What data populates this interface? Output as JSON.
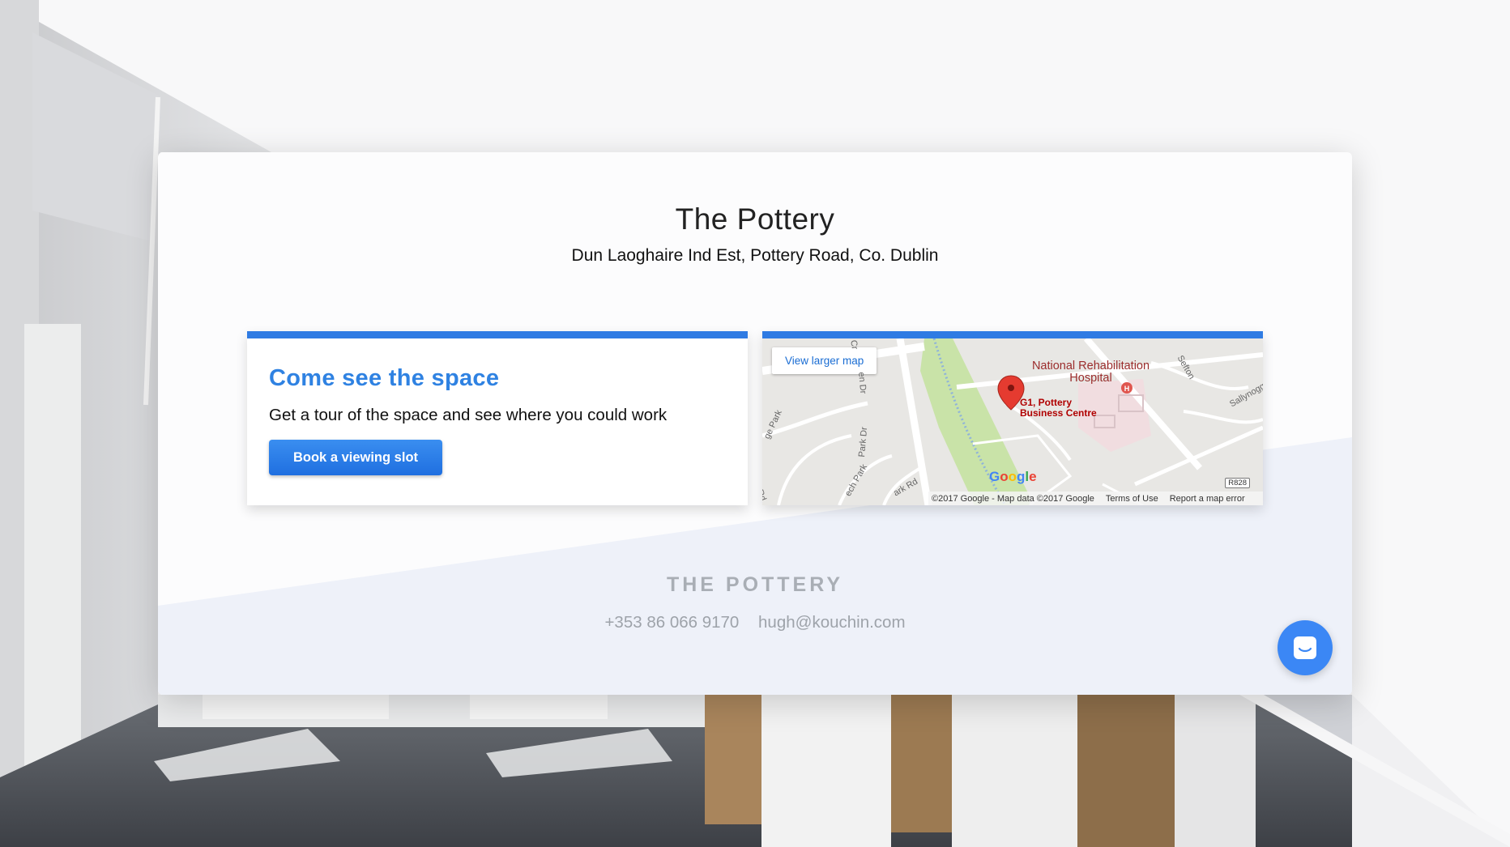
{
  "header": {
    "title": "The Pottery",
    "address": "Dun Laoghaire Ind Est, Pottery Road, Co. Dublin"
  },
  "cta": {
    "heading": "Come see the space",
    "text": "Get a tour of the space and see where you could work",
    "button_label": "Book a viewing slot"
  },
  "map": {
    "view_larger": "View larger map",
    "place_name": "National Rehabilitation Hospital",
    "pin_label": "G1, Pottery Business Centre",
    "streets": [
      "Sefton",
      "Sallynoggin",
      "en Dr",
      "ge Park",
      "Park Dr",
      "ech Park",
      "ark Rd",
      "Rd",
      "Cr"
    ],
    "road_badge": "R828",
    "hospital_marker": "H",
    "google_logo": "Google",
    "footer": {
      "copyright": "©2017 Google - Map data ©2017 Google",
      "terms": "Terms of Use",
      "report": "Report a map error"
    }
  },
  "footer": {
    "brand": "THE POTTERY",
    "phone": "+353 86 066 9170",
    "email": "hugh@kouchin.com"
  },
  "colors": {
    "accent": "#2f7be3",
    "heading_blue": "#2f82e2",
    "chat_button": "#3b87f5",
    "footer_band": "#eef1f9"
  }
}
